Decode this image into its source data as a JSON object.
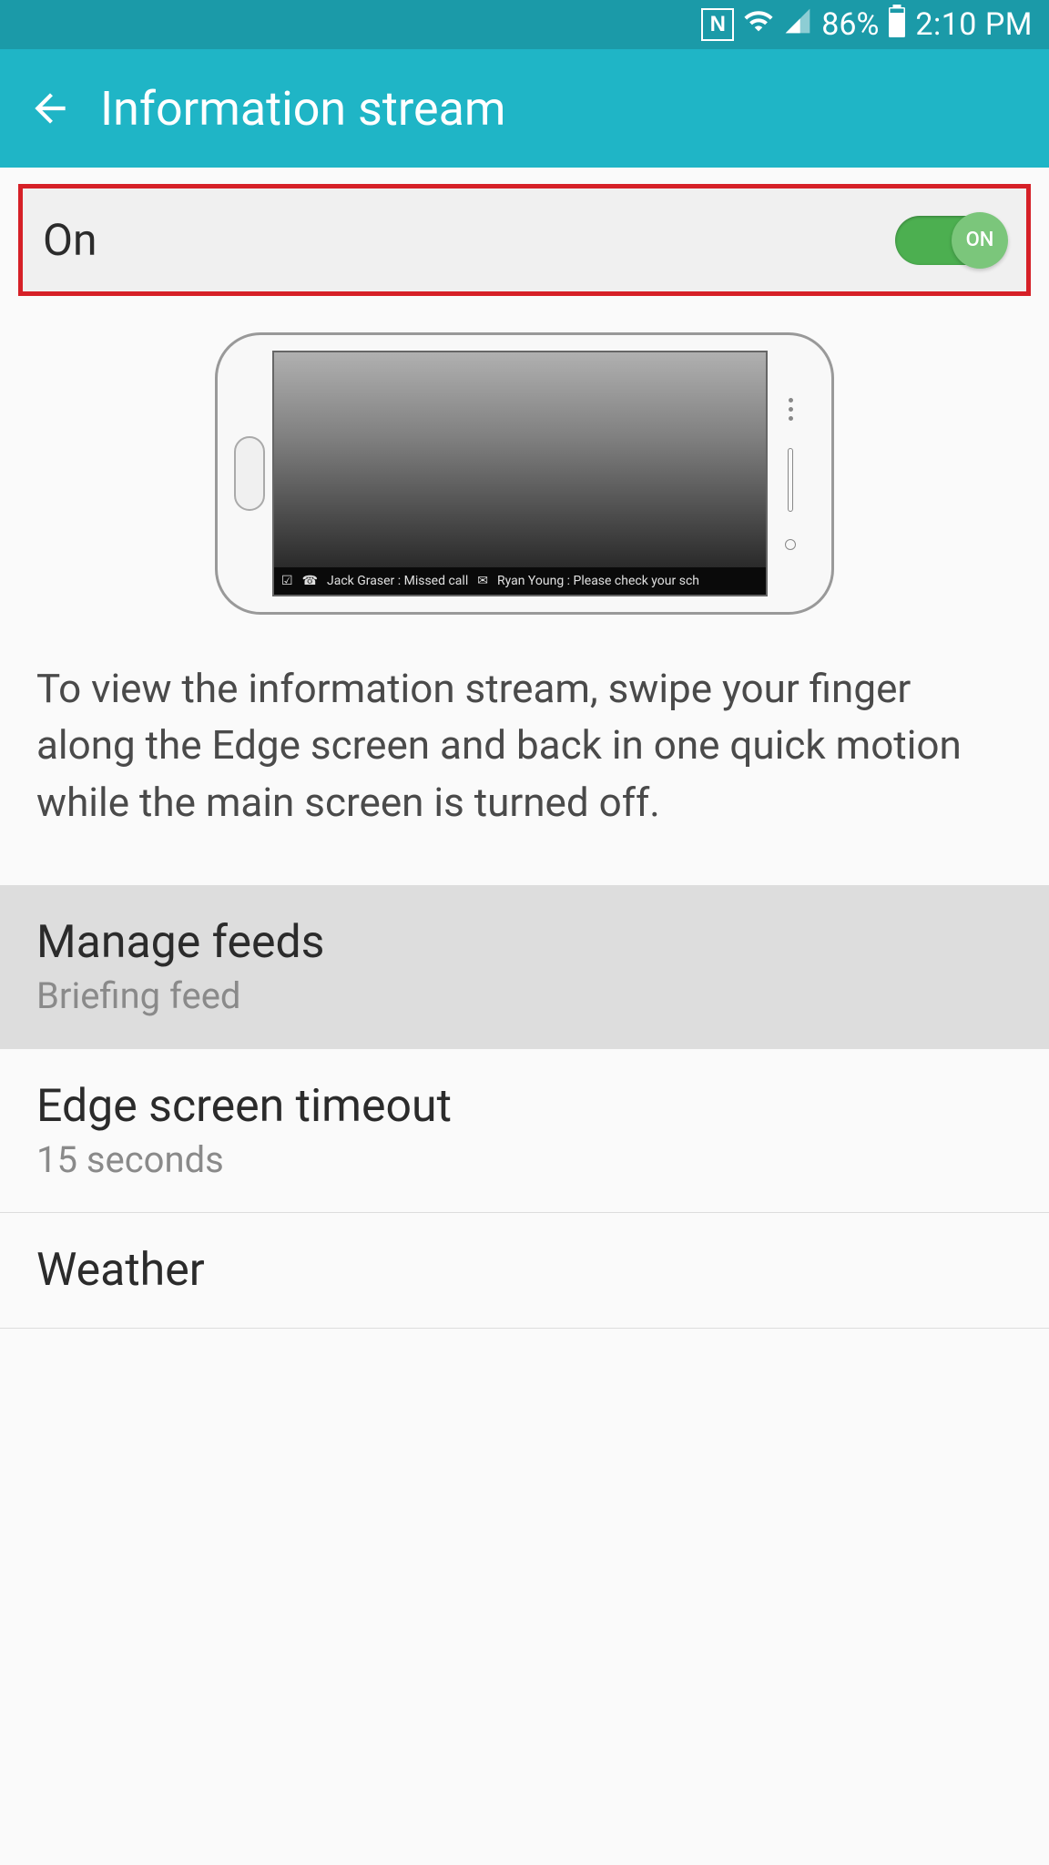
{
  "status_bar": {
    "battery_pct": "86%",
    "time": "2:10 PM"
  },
  "app_bar": {
    "title": "Information stream"
  },
  "toggle": {
    "label": "On",
    "knob_text": "ON"
  },
  "preview": {
    "ticker": {
      "item1": "Jack Graser : Missed call",
      "item2": "Ryan Young : Please check your sch"
    },
    "description": "To view the information stream, swipe your finger along the Edge screen and back in one quick motion while the main screen is turned off."
  },
  "settings": {
    "manage_feeds": {
      "title": "Manage feeds",
      "subtitle": "Briefing feed"
    },
    "edge_timeout": {
      "title": "Edge screen timeout",
      "subtitle": "15 seconds"
    },
    "weather": {
      "title": "Weather"
    }
  }
}
